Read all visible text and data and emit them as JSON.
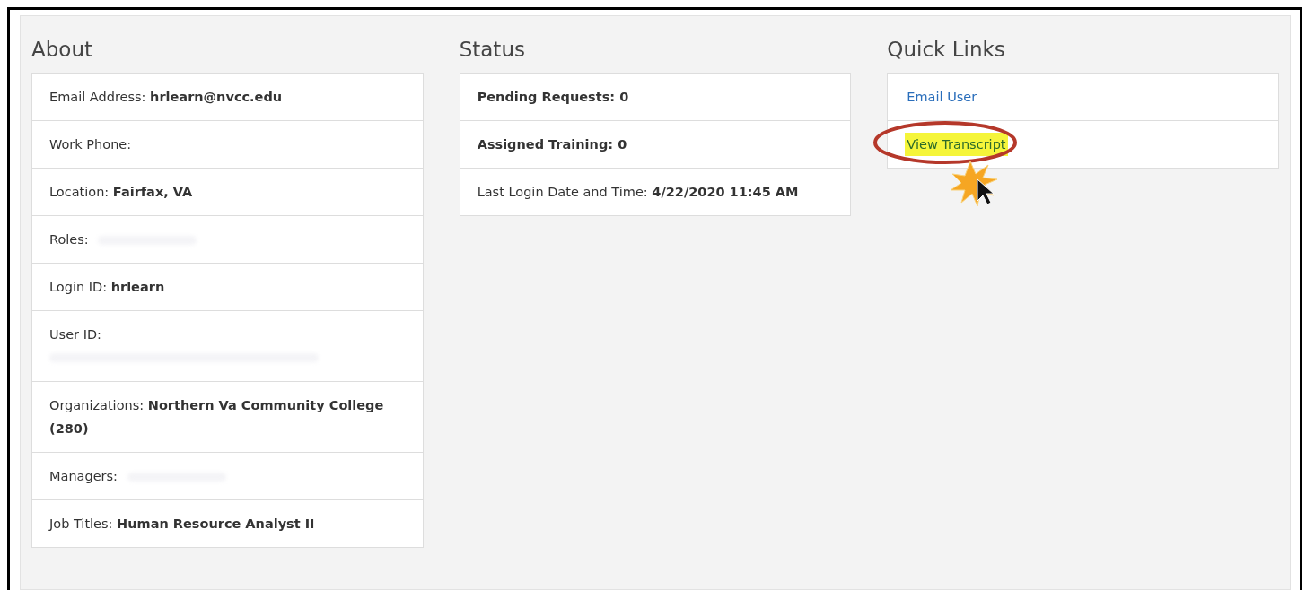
{
  "columns": [
    {
      "title": "About",
      "rows": [
        {
          "label": "Email Address:",
          "value": "hrlearn@nvcc.edu"
        },
        {
          "label": "Work Phone:"
        },
        {
          "label": "Location:",
          "value": "Fairfax, VA"
        },
        {
          "label": "Roles:",
          "redacted": true
        },
        {
          "label": "Login ID:",
          "value": "hrlearn"
        },
        {
          "label": "User ID:",
          "redacted": true,
          "redacted_below": true
        },
        {
          "label": "Organizations:",
          "value": "Northern Va Community College (280)"
        },
        {
          "label": "Managers:",
          "redacted": true
        },
        {
          "label": "Job Titles:",
          "value": "Human Resource Analyst II"
        }
      ]
    },
    {
      "title": "Status",
      "rows": [
        {
          "label": "Pending Requests:",
          "value": "0",
          "bold_label": true
        },
        {
          "label": "Assigned Training:",
          "value": "0",
          "bold_label": true
        },
        {
          "label": "Last Login Date and Time:",
          "value": "4/22/2020 11:45 AM",
          "bold_label": false
        }
      ]
    },
    {
      "title": "Quick Links",
      "links": [
        {
          "label": "Email User",
          "highlighted": false
        },
        {
          "label": "View Transcript",
          "highlighted": true
        }
      ]
    }
  ]
}
